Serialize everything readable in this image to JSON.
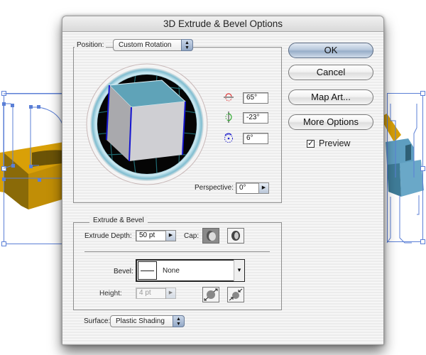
{
  "dialog": {
    "title": "3D Extrude & Bevel Options"
  },
  "position": {
    "label": "Position:",
    "preset": "Custom Rotation",
    "rotation_x_icon": "rotate-x-axis-icon",
    "rotation_y_icon": "rotate-y-axis-icon",
    "rotation_z_icon": "rotate-z-axis-icon",
    "rotation_x": "65°",
    "rotation_y": "-23°",
    "rotation_z": "6°",
    "perspective_label": "Perspective:",
    "perspective": "0°"
  },
  "buttons": {
    "ok": "OK",
    "cancel": "Cancel",
    "map_art": "Map Art...",
    "more_options": "More Options"
  },
  "preview": {
    "label": "Preview",
    "checked": true,
    "mark": "✓"
  },
  "extrude_bevel": {
    "group_label": "Extrude & Bevel",
    "depth_label": "Extrude Depth:",
    "depth": "50 pt",
    "cap_label": "Cap:",
    "cap_on_icon": "cap-on-icon",
    "cap_off_icon": "cap-off-icon",
    "bevel_label": "Bevel:",
    "bevel": "None",
    "height_label": "Height:",
    "height": "4 pt",
    "bevel_out_icon": "bevel-extent-out-icon",
    "bevel_in_icon": "bevel-extent-in-icon"
  },
  "surface": {
    "label": "Surface:",
    "value": "Plastic Shading"
  },
  "glyphs": {
    "stepper_arrow": "▶",
    "popup_arrows": "▲▼",
    "dropdown_arrow": "▾"
  },
  "colors": {
    "cube_top": "#5fa3b8",
    "cube_front": "#cfcfd3",
    "cube_side": "#a9a9ad",
    "edge_highlight": "#1515d0",
    "artwork_left": "#d9a007",
    "artwork_right": "#5e9ec0",
    "selection": "#5b7fd6"
  }
}
